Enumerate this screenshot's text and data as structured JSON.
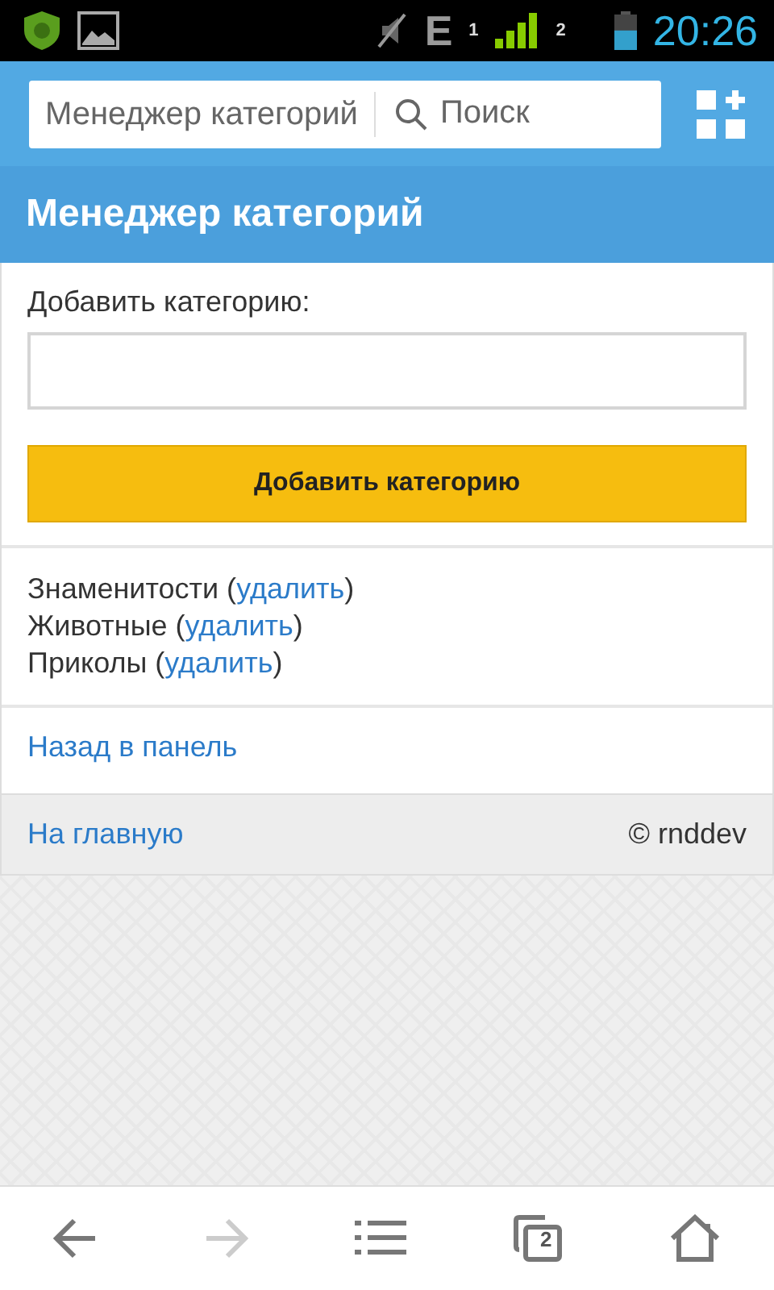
{
  "status_bar": {
    "network": "E",
    "sim_1": "1",
    "sim_2": "2",
    "time": "20:26"
  },
  "browser_bar": {
    "page_title": "Менеджер категорий",
    "search_placeholder": "Поиск"
  },
  "header": {
    "title": "Менеджер категорий"
  },
  "form": {
    "label": "Добавить категорию:",
    "button": "Добавить категорию"
  },
  "categories": [
    {
      "before": "Знаменитости (",
      "link": "удалить",
      "after": ")"
    },
    {
      "before": "Животные (",
      "link": "удалить",
      "after": ")"
    },
    {
      "before": "Приколы (",
      "link": "удалить",
      "after": ")"
    }
  ],
  "back_link": "Назад в панель",
  "footer": {
    "home_link": "На главную",
    "copyright": "© rnddev"
  },
  "nav_bar": {
    "back_enabled": true,
    "forward_enabled": false,
    "tab_count": "2"
  }
}
